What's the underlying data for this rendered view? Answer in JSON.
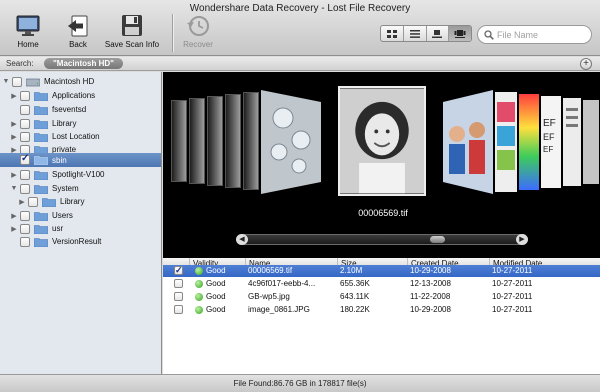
{
  "window": {
    "title": "Wondershare Data Recovery - Lost File Recovery"
  },
  "toolbar": {
    "home_label": "Home",
    "back_label": "Back",
    "save_scan_label": "Save Scan Info",
    "recover_label": "Recover",
    "view_modes": [
      "icon-view-icon",
      "list-view-icon",
      "column-view-icon",
      "coverflow-view-icon"
    ],
    "active_view": "coverflow-view-icon"
  },
  "search": {
    "placeholder": "File Name"
  },
  "pathbar": {
    "label": "Search:",
    "token": "\"Macintosh HD\"",
    "add_label": "+"
  },
  "sidebar": {
    "items": [
      {
        "label": "Macintosh HD",
        "disclosure": "▼",
        "checked": false,
        "level": 0
      },
      {
        "label": "Applications",
        "disclosure": "▶",
        "checked": false,
        "level": 1
      },
      {
        "label": "fseventsd",
        "disclosure": "",
        "checked": false,
        "level": 1
      },
      {
        "label": "Library",
        "disclosure": "▶",
        "checked": false,
        "level": 1
      },
      {
        "label": "Lost Location",
        "disclosure": "▶",
        "checked": false,
        "level": 1
      },
      {
        "label": "private",
        "disclosure": "▶",
        "checked": false,
        "level": 1
      },
      {
        "label": "sbin",
        "disclosure": "",
        "checked": true,
        "level": 1,
        "selected": true
      },
      {
        "label": "Spotlight-V100",
        "disclosure": "▶",
        "checked": false,
        "level": 1
      },
      {
        "label": "System",
        "disclosure": "▼",
        "checked": false,
        "level": 1
      },
      {
        "label": "Library",
        "disclosure": "▶",
        "checked": false,
        "level": 2
      },
      {
        "label": "Users",
        "disclosure": "▶",
        "checked": false,
        "level": 1
      },
      {
        "label": "usr",
        "disclosure": "▶",
        "checked": false,
        "level": 1
      },
      {
        "label": "VersionResult",
        "disclosure": "",
        "checked": false,
        "level": 1
      }
    ]
  },
  "coverflow": {
    "caption": "00006569.tif",
    "left_arrow": "◀",
    "right_arrow": "▶"
  },
  "table": {
    "headers": [
      "Validity",
      "Name",
      "Size",
      "Created Date",
      "Modified Date"
    ],
    "rows": [
      {
        "checked": true,
        "validity": "Good",
        "name": "00006569.tif",
        "size": "2.10M",
        "created": "10-29-2008",
        "modified": "10-27-2011",
        "selected": true
      },
      {
        "checked": false,
        "validity": "Good",
        "name": "4c96f017-eebb-4...",
        "size": "655.36K",
        "created": "12-13-2008",
        "modified": "10-27-2011"
      },
      {
        "checked": false,
        "validity": "Good",
        "name": "GB-wp5.jpg",
        "size": "643.11K",
        "created": "11-22-2008",
        "modified": "10-27-2011"
      },
      {
        "checked": false,
        "validity": "Good",
        "name": "image_0861.JPG",
        "size": "180.22K",
        "created": "10-29-2008",
        "modified": "10-27-2011"
      }
    ]
  },
  "status": {
    "text": "File Found:86.76 GB in 178817 file(s)"
  },
  "colors": {
    "selection": "#3467c6",
    "sidebar_bg": "#e3e8ef",
    "valid_green": "#35a31c"
  }
}
